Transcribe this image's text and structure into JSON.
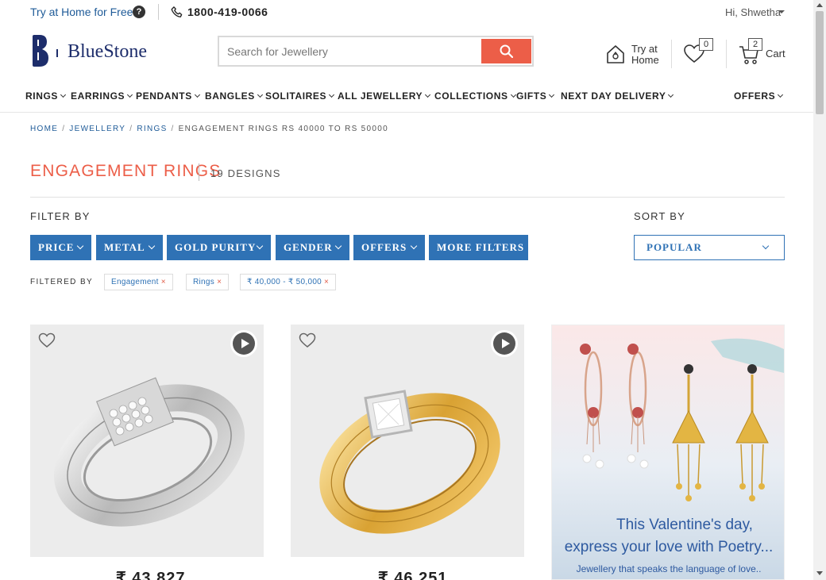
{
  "topbar": {
    "try_home": "Try at Home for Free",
    "phone": "1800-419-0066",
    "greeting": "Hi, Shwetha"
  },
  "header": {
    "logo_text": "BlueStone",
    "search_placeholder": "Search for Jewellery",
    "try_at_home_label": "Try at Home",
    "wishlist_count": "0",
    "cart_count": "2",
    "cart_label": "Cart"
  },
  "nav": {
    "items": [
      "RINGS",
      "EARRINGS",
      "PENDANTS",
      "BANGLES",
      "SOLITAIRES",
      "ALL JEWELLERY",
      "COLLECTIONS",
      "GIFTS",
      "NEXT DAY DELIVERY",
      "OFFERS"
    ]
  },
  "breadcrumb": {
    "items": [
      "HOME",
      "JEWELLERY",
      "RINGS"
    ],
    "current": "ENGAGEMENT RINGS RS 40000 TO RS 50000"
  },
  "listing": {
    "title": "ENGAGEMENT RINGS",
    "count": "19 DESIGNS"
  },
  "filters": {
    "label": "FILTER BY",
    "buttons": [
      "PRICE",
      "METAL",
      "GOLD PURITY",
      "GENDER",
      "OFFERS",
      "MORE FILTERS"
    ],
    "filtered_by_label": "FILTERED BY",
    "chips": [
      "Engagement",
      "Rings",
      "₹ 40,000 - ₹ 50,000"
    ],
    "chip_remove": "×"
  },
  "sort": {
    "label": "SORT BY",
    "selected": "POPULAR"
  },
  "products": [
    {
      "price": "₹ 43,827",
      "metal": "white-gold"
    },
    {
      "price": "₹ 46,251",
      "metal": "yellow-gold"
    }
  ],
  "promo": {
    "line1": "This Valentine's day,",
    "line2": "express your love with Poetry...",
    "line3": "Jewellery that speaks the language of love.."
  },
  "colors": {
    "accent": "#ec5e48",
    "brand_blue": "#2f72b5",
    "logo_navy": "#1d2d6b"
  }
}
